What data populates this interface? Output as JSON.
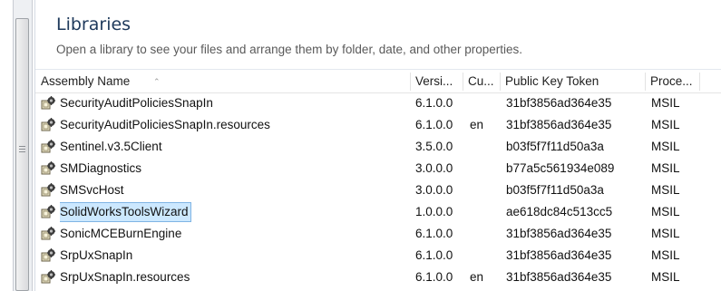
{
  "header": {
    "title": "Libraries",
    "subtitle": "Open a library to see your files and arrange them by folder, date, and other properties."
  },
  "columns": {
    "name": "Assembly Name",
    "version": "Versi...",
    "culture": "Cu...",
    "token": "Public Key Token",
    "processor": "Proce..."
  },
  "icons": {
    "assembly": "assembly-gear-icon",
    "sort": "sort-ascending-icon"
  },
  "rows": [
    {
      "name": "SecurityAuditPoliciesSnapIn",
      "version": "6.1.0.0",
      "culture": "",
      "token": "31bf3856ad364e35",
      "processor": "MSIL"
    },
    {
      "name": "SecurityAuditPoliciesSnapIn.resources",
      "version": "6.1.0.0",
      "culture": "en",
      "token": "31bf3856ad364e35",
      "processor": "MSIL"
    },
    {
      "name": "Sentinel.v3.5Client",
      "version": "3.5.0.0",
      "culture": "",
      "token": "b03f5f7f11d50a3a",
      "processor": "MSIL"
    },
    {
      "name": "SMDiagnostics",
      "version": "3.0.0.0",
      "culture": "",
      "token": "b77a5c561934e089",
      "processor": "MSIL"
    },
    {
      "name": "SMSvcHost",
      "version": "3.0.0.0",
      "culture": "",
      "token": "b03f5f7f11d50a3a",
      "processor": "MSIL"
    },
    {
      "name": "SolidWorksToolsWizard",
      "version": "1.0.0.0",
      "culture": "",
      "token": "ae618dc84c513cc5",
      "processor": "MSIL",
      "selected": true
    },
    {
      "name": "SonicMCEBurnEngine",
      "version": "6.1.0.0",
      "culture": "",
      "token": "31bf3856ad364e35",
      "processor": "MSIL"
    },
    {
      "name": "SrpUxSnapIn",
      "version": "6.1.0.0",
      "culture": "",
      "token": "31bf3856ad364e35",
      "processor": "MSIL"
    },
    {
      "name": "SrpUxSnapIn.resources",
      "version": "6.1.0.0",
      "culture": "en",
      "token": "31bf3856ad364e35",
      "processor": "MSIL"
    }
  ]
}
